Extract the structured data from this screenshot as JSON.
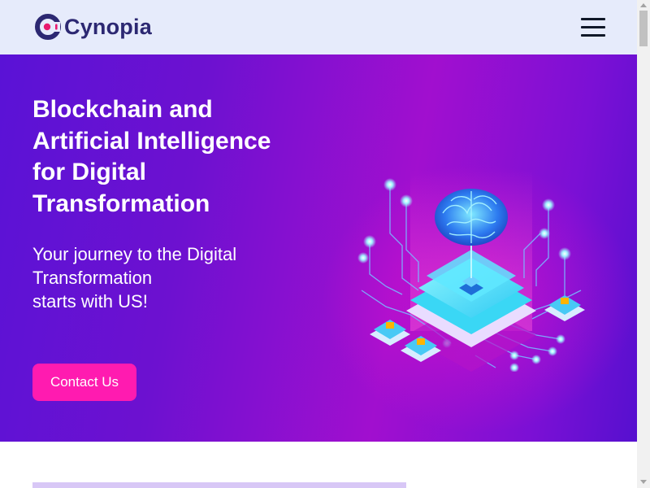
{
  "header": {
    "logo_text": "Cynopia",
    "logo_icon": "cynopia-logo-icon",
    "menu_icon": "hamburger-menu-icon"
  },
  "hero": {
    "title": "Blockchain and Artificial Intelligence for Digital Transformation",
    "subtitle_lines": [
      "Your journey to the Digital",
      "Transformation",
      "starts with US!"
    ],
    "cta_label": "Contact Us",
    "illustration_icon": "ai-brain-chip-icon"
  },
  "colors": {
    "header_bg": "#e6ebfb",
    "logo_text": "#2c2872",
    "hero_gradient_start": "#5a12d6",
    "hero_gradient_mid": "#a10fcf",
    "cta_bg": "#ff1bb0",
    "section_bar": "#d8c7f6"
  }
}
